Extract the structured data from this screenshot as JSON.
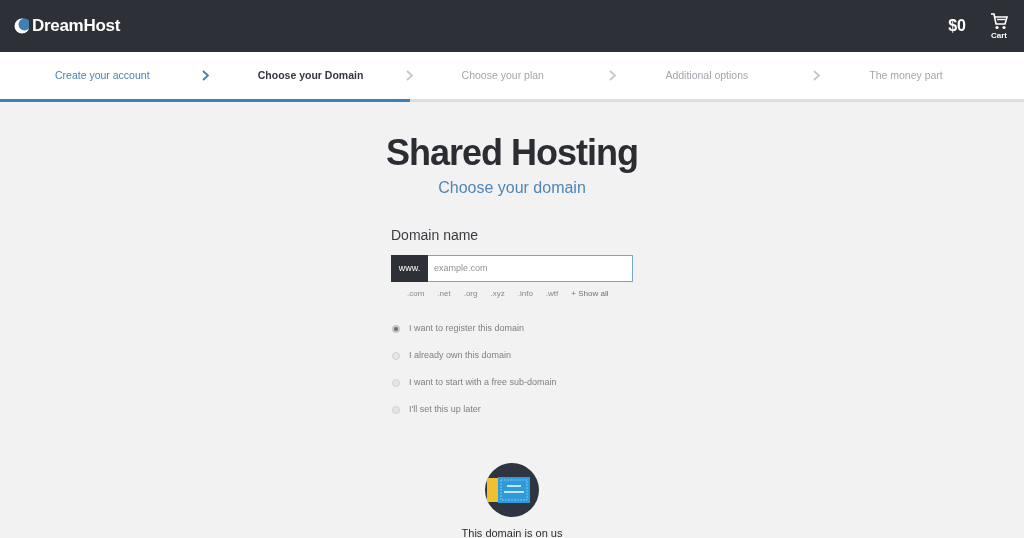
{
  "header": {
    "logo": "DreamHost",
    "total": "$0",
    "cart_label": "Cart"
  },
  "steps": [
    {
      "label": "Create your account",
      "completed": true,
      "selected": false
    },
    {
      "label": "Choose your Domain",
      "completed": false,
      "selected": true
    },
    {
      "label": "Choose your plan",
      "completed": false,
      "selected": false
    },
    {
      "label": "Additional options",
      "completed": false,
      "selected": false
    },
    {
      "label": "The money part",
      "completed": false,
      "selected": false
    }
  ],
  "progress": {
    "level": 0.4
  },
  "main": {
    "title": "Shared Hosting",
    "subtitle": "Choose your domain",
    "field_label": "Domain name",
    "prefix": "www.",
    "placeholder": "example.com",
    "tlds": [
      ".com",
      ".net",
      ".org",
      ".xyz",
      ".info",
      ".wtf"
    ],
    "show_all": "+ Show all",
    "options": [
      {
        "label": "I want to register this domain",
        "selected": true
      },
      {
        "label": "I already own this domain",
        "selected": false
      },
      {
        "label": "I want to start with a free sub-domain",
        "selected": false
      },
      {
        "label": "I'll set this up later",
        "selected": false
      }
    ],
    "promo": "This domain is on us"
  }
}
